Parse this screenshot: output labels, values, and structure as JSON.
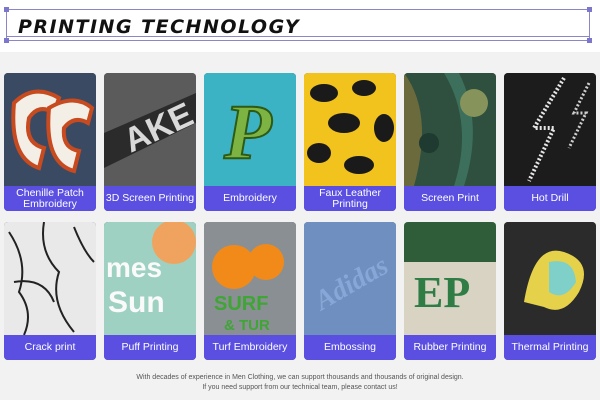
{
  "header": {
    "title": "PRINTING  TECHNOLOGY",
    "accent": "#5a4fe0"
  },
  "tiles": [
    {
      "label": "Chenille Patch Embroidery",
      "icon": "chenille-patch-image"
    },
    {
      "label": "3D Screen Printing",
      "icon": "3d-screen-print-image"
    },
    {
      "label": "Embroidery",
      "icon": "embroidery-image"
    },
    {
      "label": "Faux Leather Printing",
      "icon": "faux-leather-image"
    },
    {
      "label": "Screen Print",
      "icon": "screen-print-image"
    },
    {
      "label": "Hot Drill",
      "icon": "hot-drill-image"
    },
    {
      "label": "Crack print",
      "icon": "crack-print-image"
    },
    {
      "label": "Puff Printing",
      "icon": "puff-print-image"
    },
    {
      "label": "Turf Embroidery",
      "icon": "turf-embroidery-image"
    },
    {
      "label": "Embossing",
      "icon": "embossing-image"
    },
    {
      "label": "Rubber Printing",
      "icon": "rubber-print-image"
    },
    {
      "label": "Thermal Printing",
      "icon": "thermal-print-image"
    }
  ],
  "footer": {
    "line1": "With decades of experience in Men Clothing, we can support thousands and thousands of original design.",
    "line2": "If you need support from our technical team, please contact us!"
  }
}
